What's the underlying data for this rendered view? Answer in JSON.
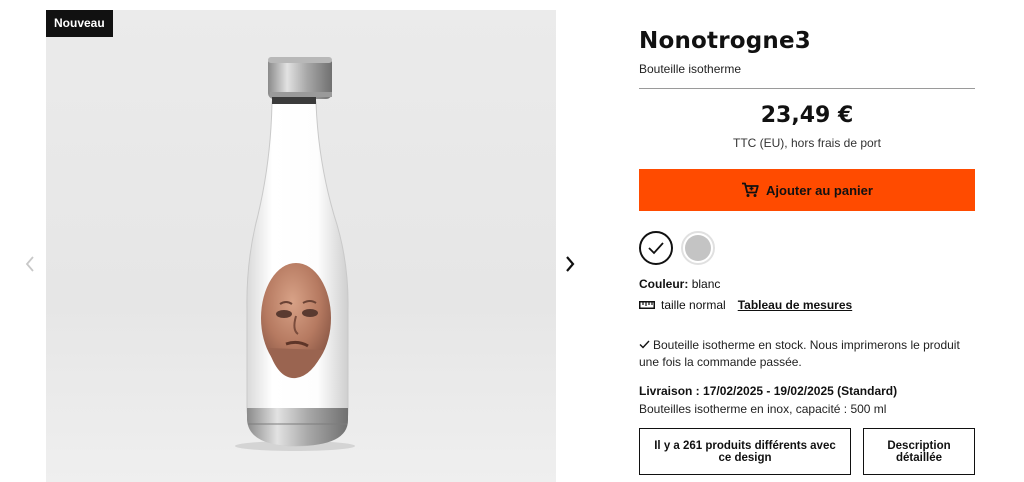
{
  "gallery": {
    "badge": "Nouveau"
  },
  "product": {
    "title": "Nonotrogne3",
    "subtitle": "Bouteille isotherme",
    "price": "23,49 €",
    "price_note": "TTC (EU), hors frais de port",
    "add_to_cart": "Ajouter au panier",
    "color_label": "Couleur:",
    "color_value": "blanc",
    "size_value": "taille normal",
    "size_chart_link": "Tableau de mesures",
    "stock_text": "Bouteille isotherme en stock. Nous imprimerons le produit une fois la commande passée.",
    "delivery_text": "Livraison : 17/02/2025 - 19/02/2025 (Standard)",
    "material_text": "Bouteilles isotherme en inox, capacité : 500 ml",
    "designs_button": "Il y a 261 produits différents avec ce design",
    "description_button": "Description détaillée"
  },
  "colors": {
    "accent": "#ff4b00",
    "swatch_grey": "#c4c4c4"
  }
}
